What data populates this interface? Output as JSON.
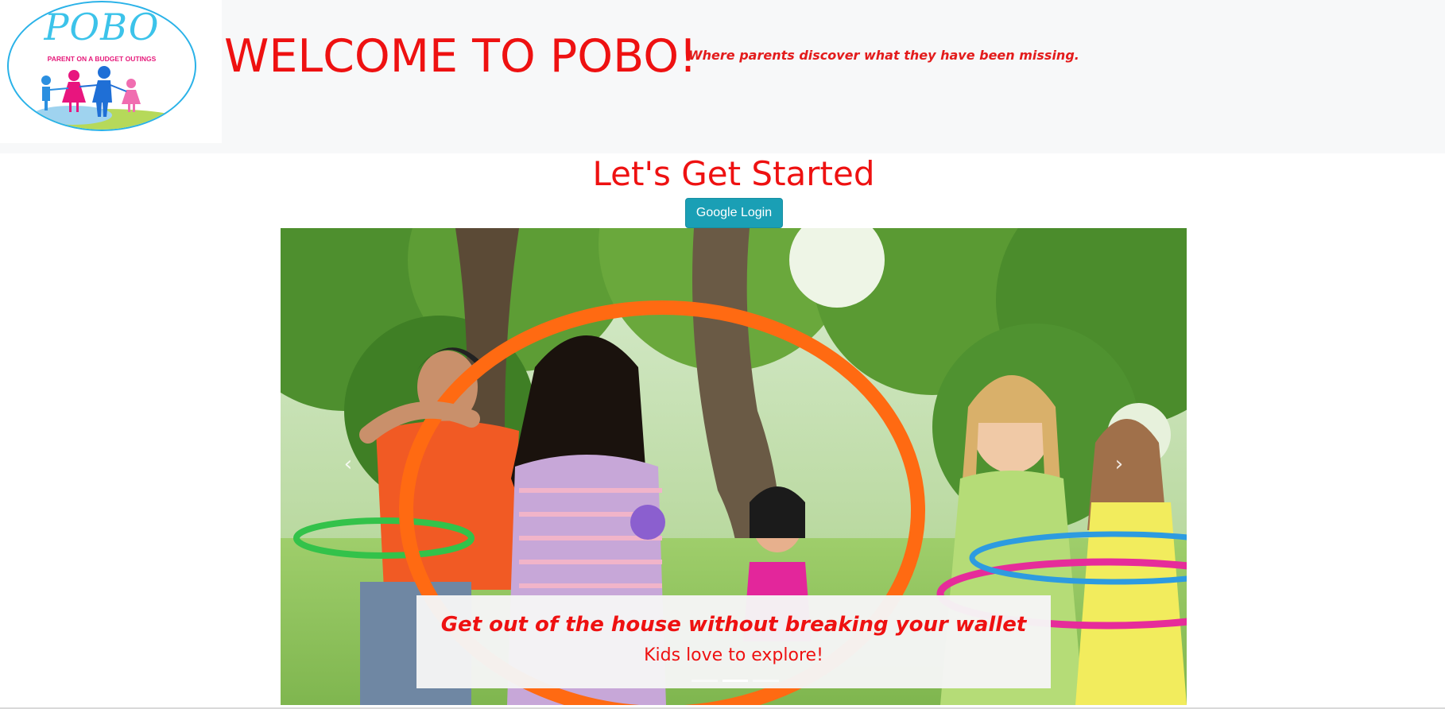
{
  "header": {
    "logo_title": "POBO",
    "logo_subtitle": "PARENT ON A BUDGET OUTINGS",
    "welcome": "WELCOME TO POBO!",
    "tagline": "Where parents discover what they have been missing."
  },
  "main": {
    "heading": "Let's Get Started",
    "login_label": "Google Login"
  },
  "carousel": {
    "caption_title": "Get out of the house without breaking your wallet",
    "caption_sub": "Kids love to explore!",
    "prev_icon": "chevron-left-icon",
    "next_icon": "chevron-right-icon",
    "slide_count": 3,
    "active_slide": 2
  },
  "colors": {
    "brand_red": "#ee1111",
    "button_teal": "#1a9fb5",
    "header_bg": "#f7f8f9"
  }
}
